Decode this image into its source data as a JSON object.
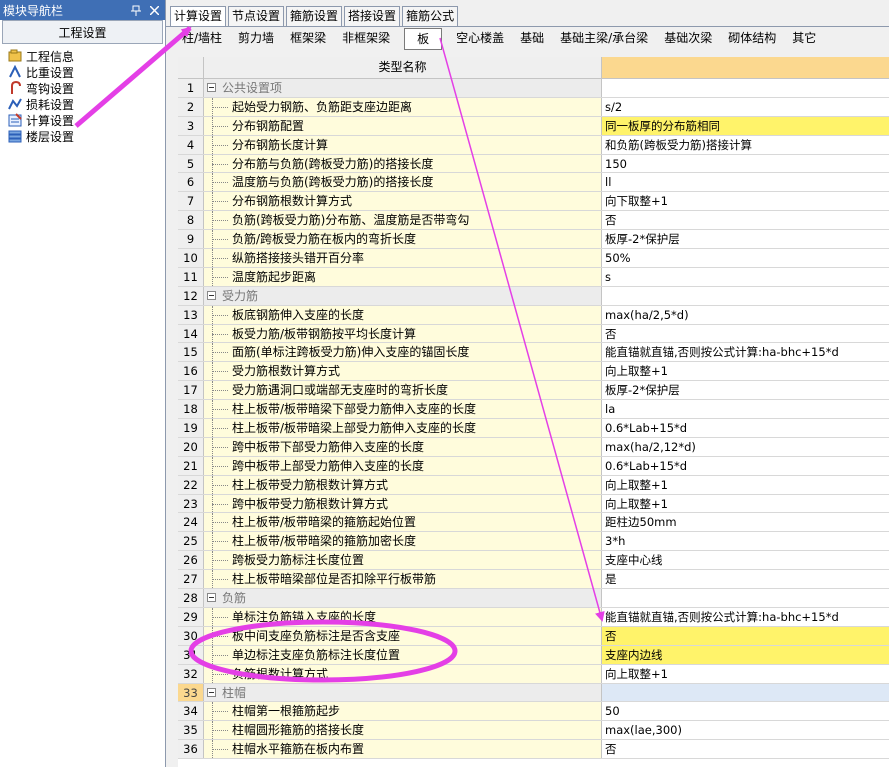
{
  "nav": {
    "title": "模块导航栏",
    "pin_icon": "pin-icon",
    "close_icon": "close-icon",
    "header": "工程设置",
    "items": [
      {
        "label": "工程信息",
        "icon": "project-info-icon"
      },
      {
        "label": "比重设置",
        "icon": "weight-settings-icon"
      },
      {
        "label": "弯钩设置",
        "icon": "hook-settings-icon"
      },
      {
        "label": "损耗设置",
        "icon": "loss-settings-icon"
      },
      {
        "label": "计算设置",
        "icon": "calc-settings-icon"
      },
      {
        "label": "楼层设置",
        "icon": "floor-settings-icon"
      }
    ]
  },
  "tabs": [
    "计算设置",
    "节点设置",
    "箍筋设置",
    "搭接设置",
    "箍筋公式"
  ],
  "active_tab": 0,
  "subtabs": [
    "柱/墙柱",
    "剪力墙",
    "框架梁",
    "非框架梁",
    "板",
    "空心楼盖",
    "基础",
    "基础主梁/承台梁",
    "基础次梁",
    "砌体结构",
    "其它"
  ],
  "active_subtab": 4,
  "grid": {
    "header": "类型名称",
    "rows": [
      {
        "n": "1",
        "name": "公共设置项",
        "val": "",
        "group": true
      },
      {
        "n": "2",
        "name": "起始受力钢筋、负筋距支座边距离",
        "val": "s/2"
      },
      {
        "n": "3",
        "name": "分布钢筋配置",
        "val": "同一板厚的分布筋相同",
        "hl": true
      },
      {
        "n": "4",
        "name": "分布钢筋长度计算",
        "val": "和负筋(跨板受力筋)搭接计算"
      },
      {
        "n": "5",
        "name": "分布筋与负筋(跨板受力筋)的搭接长度",
        "val": "150"
      },
      {
        "n": "6",
        "name": "温度筋与负筋(跨板受力筋)的搭接长度",
        "val": "ll"
      },
      {
        "n": "7",
        "name": "分布钢筋根数计算方式",
        "val": "向下取整+1"
      },
      {
        "n": "8",
        "name": "负筋(跨板受力筋)分布筋、温度筋是否带弯勾",
        "val": "否"
      },
      {
        "n": "9",
        "name": "负筋/跨板受力筋在板内的弯折长度",
        "val": "板厚-2*保护层"
      },
      {
        "n": "10",
        "name": "纵筋搭接接头错开百分率",
        "val": "50%"
      },
      {
        "n": "11",
        "name": "温度筋起步距离",
        "val": "s"
      },
      {
        "n": "12",
        "name": "受力筋",
        "val": "",
        "group": true
      },
      {
        "n": "13",
        "name": "板底钢筋伸入支座的长度",
        "val": "max(ha/2,5*d)"
      },
      {
        "n": "14",
        "name": "板受力筋/板带钢筋按平均长度计算",
        "val": "否"
      },
      {
        "n": "15",
        "name": "面筋(单标注跨板受力筋)伸入支座的锚固长度",
        "val": "能直锚就直锚,否则按公式计算:ha-bhc+15*d"
      },
      {
        "n": "16",
        "name": "受力筋根数计算方式",
        "val": "向上取整+1"
      },
      {
        "n": "17",
        "name": "受力筋遇洞口或端部无支座时的弯折长度",
        "val": "板厚-2*保护层"
      },
      {
        "n": "18",
        "name": "柱上板带/板带暗梁下部受力筋伸入支座的长度",
        "val": "la"
      },
      {
        "n": "19",
        "name": "柱上板带/板带暗梁上部受力筋伸入支座的长度",
        "val": "0.6*Lab+15*d"
      },
      {
        "n": "20",
        "name": "跨中板带下部受力筋伸入支座的长度",
        "val": "max(ha/2,12*d)"
      },
      {
        "n": "21",
        "name": "跨中板带上部受力筋伸入支座的长度",
        "val": "0.6*Lab+15*d"
      },
      {
        "n": "22",
        "name": "柱上板带受力筋根数计算方式",
        "val": "向上取整+1"
      },
      {
        "n": "23",
        "name": "跨中板带受力筋根数计算方式",
        "val": "向上取整+1"
      },
      {
        "n": "24",
        "name": "柱上板带/板带暗梁的箍筋起始位置",
        "val": "距柱边50mm"
      },
      {
        "n": "25",
        "name": "柱上板带/板带暗梁的箍筋加密长度",
        "val": "3*h"
      },
      {
        "n": "26",
        "name": "跨板受力筋标注长度位置",
        "val": "支座中心线"
      },
      {
        "n": "27",
        "name": "柱上板带暗梁部位是否扣除平行板带筋",
        "val": "是"
      },
      {
        "n": "28",
        "name": "负筋",
        "val": "",
        "group": true
      },
      {
        "n": "29",
        "name": "单标注负筋锚入支座的长度",
        "val": "能直锚就直锚,否则按公式计算:ha-bhc+15*d"
      },
      {
        "n": "30",
        "name": "板中间支座负筋标注是否含支座",
        "val": "否",
        "hl": true
      },
      {
        "n": "31",
        "name": "单边标注支座负筋标注长度位置",
        "val": "支座内边线",
        "hl": true
      },
      {
        "n": "32",
        "name": "负筋根数计算方式",
        "val": "向上取整+1"
      },
      {
        "n": "33",
        "name": "柱帽",
        "val": "",
        "group": true,
        "selected": true
      },
      {
        "n": "34",
        "name": "柱帽第一根箍筋起步",
        "val": "50"
      },
      {
        "n": "35",
        "name": "柱帽圆形箍筋的搭接长度",
        "val": "max(lae,300)"
      },
      {
        "n": "36",
        "name": "柱帽水平箍筋在板内布置",
        "val": "否"
      }
    ]
  },
  "annotation_color": "#e43fe6"
}
